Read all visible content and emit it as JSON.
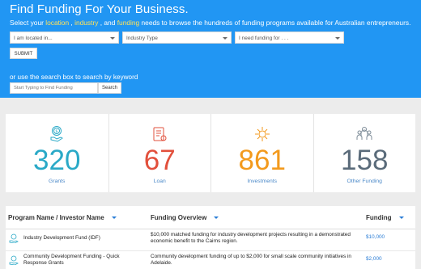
{
  "hero": {
    "title": "Find Funding For Your Business.",
    "subtitle_pre": "Select your ",
    "kw_location": "location",
    "sep1": " , ",
    "kw_industry": "industry",
    "sep2": " , and ",
    "kw_funding": "funding",
    "subtitle_post": " needs to browse the hundreds of funding programs available for Australian entrepreneurs.",
    "highlight_color": "#ffe25a"
  },
  "filters": {
    "location": "I am located in...",
    "industry": "Industry Type",
    "funding": "I need funding for . . .",
    "submit_label": "SUBMIT"
  },
  "search": {
    "or_text": "or use the search box to search by keyword",
    "placeholder": "Start Typing to Find Funding",
    "button_label": "Search"
  },
  "stats": [
    {
      "value": "320",
      "label": "Grants",
      "color": "#2aa9c7",
      "icon": "money-hand-icon"
    },
    {
      "value": "67",
      "label": "Loan",
      "color": "#e2503c",
      "icon": "loan-document-icon"
    },
    {
      "value": "861",
      "label": "Investments",
      "color": "#f39a1d",
      "icon": "investment-gear-icon"
    },
    {
      "value": "158",
      "label": "Other Funding",
      "color": "#5a6b7a",
      "icon": "people-group-icon"
    }
  ],
  "table": {
    "headers": {
      "name": "Program Name / Investor Name",
      "overview": "Funding Overview",
      "funding": "Funding"
    },
    "rows": [
      {
        "name": "Industry Development Fund (IDF)",
        "overview": "$10,000 matched funding for industry development projects resulting in a demonstrated economic benefit to the Cairns region.",
        "amount": "$10,000"
      },
      {
        "name": "Community Development Funding - Quick Response Grants",
        "overview": "Community development funding of up to $2,000 for small scale community initiatives in Adelaide.",
        "amount": "$2,000"
      }
    ]
  },
  "colors": {
    "hero_bg": "#2196f3",
    "link": "#2a7dd6"
  }
}
